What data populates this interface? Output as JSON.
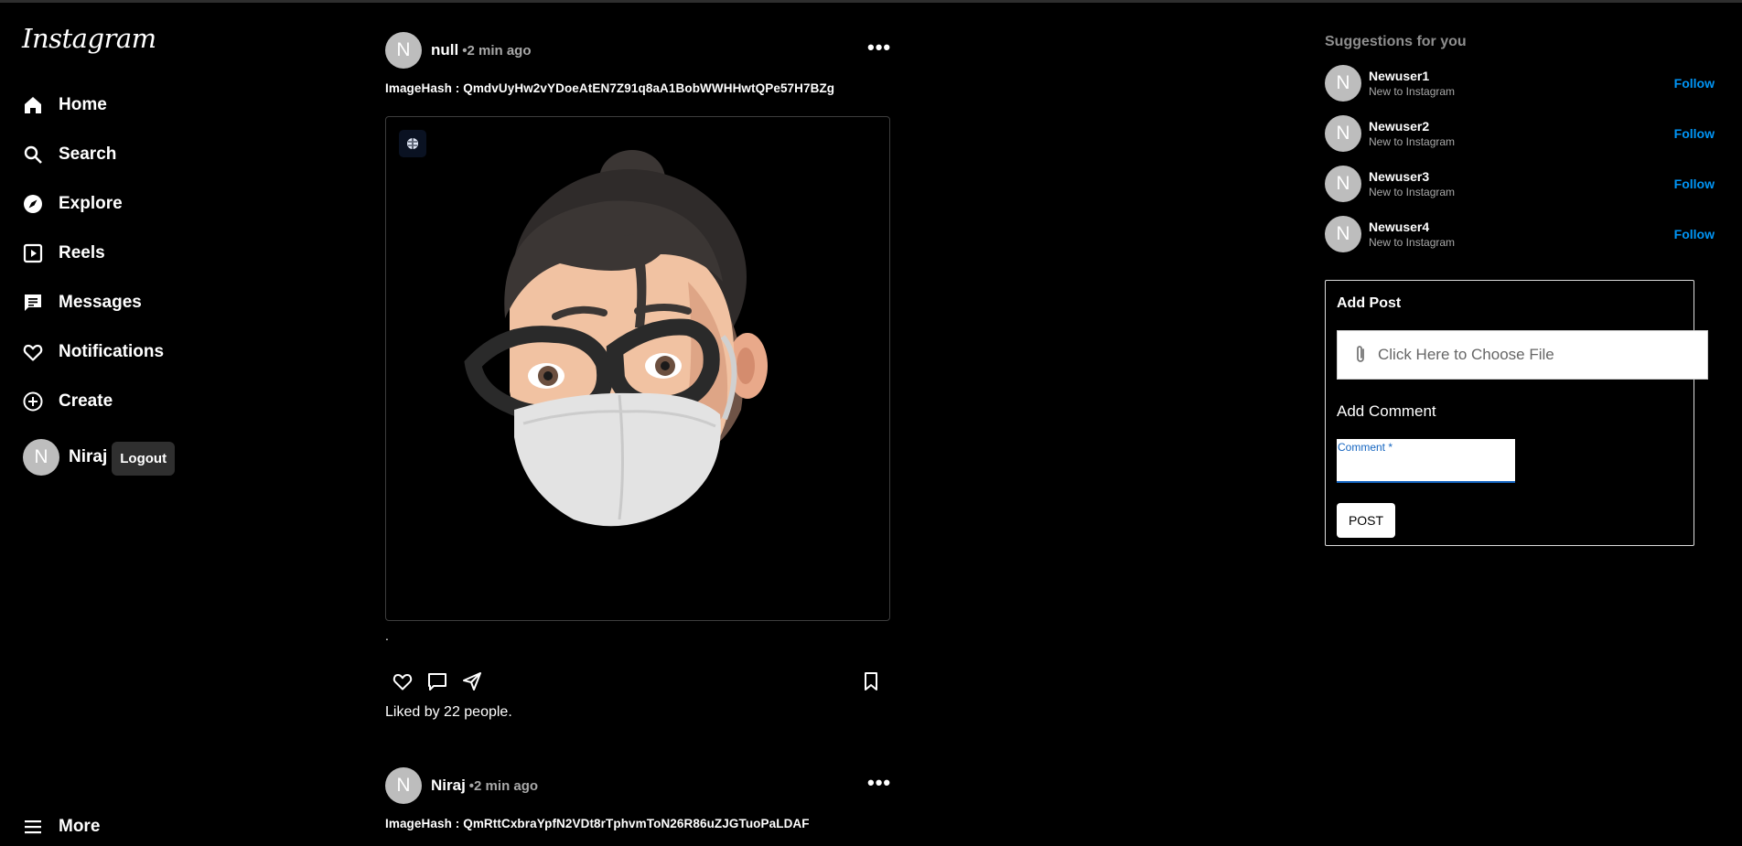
{
  "sidebar": {
    "logo": "Instagram",
    "items": [
      {
        "label": "Home",
        "icon": "home-icon"
      },
      {
        "label": "Search",
        "icon": "search-icon"
      },
      {
        "label": "Explore",
        "icon": "compass-icon"
      },
      {
        "label": "Reels",
        "icon": "reels-icon"
      },
      {
        "label": "Messages",
        "icon": "messages-icon"
      },
      {
        "label": "Notifications",
        "icon": "heart-icon"
      },
      {
        "label": "Create",
        "icon": "plus-circle-icon"
      }
    ],
    "user": {
      "initial": "N",
      "name": "Niraj",
      "logout_label": "Logout"
    },
    "more_label": "More"
  },
  "feed": {
    "posts": [
      {
        "initial": "N",
        "user": "null",
        "time": "•2 min ago",
        "image_hash_label": "ImageHash : QmdvUyHw2vYDoeAtEN7Z91q8aA1BobWWHHwtQPe57H7BZg",
        "image": "memoji-avatar-with-glasses-and-mask",
        "caption": ".",
        "likes_text": "Liked by 22 people."
      },
      {
        "initial": "N",
        "user": "Niraj",
        "time": "•2 min ago",
        "image_hash_label": "ImageHash : QmRttCxbraYpfN2VDt8rTphvmToN26R86uZJGTuoPaLDAF"
      }
    ]
  },
  "suggestions": {
    "title": "Suggestions for you",
    "items": [
      {
        "initial": "N",
        "name": "Newuser1",
        "subtitle": "New to Instagram",
        "action": "Follow"
      },
      {
        "initial": "N",
        "name": "Newuser2",
        "subtitle": "New to Instagram",
        "action": "Follow"
      },
      {
        "initial": "N",
        "name": "Newuser3",
        "subtitle": "New to Instagram",
        "action": "Follow"
      },
      {
        "initial": "N",
        "name": "Newuser4",
        "subtitle": "New to Instagram",
        "action": "Follow"
      }
    ]
  },
  "add_post": {
    "title": "Add Post",
    "file_button": "Click Here to Choose File",
    "add_comment_label": "Add Comment",
    "comment_field_label": "Comment *",
    "comment_value": "",
    "post_button": "POST"
  },
  "colors": {
    "background": "#000000",
    "link": "#0095f6",
    "avatar": "#bdbdbd",
    "field_accent": "#1565c0"
  }
}
